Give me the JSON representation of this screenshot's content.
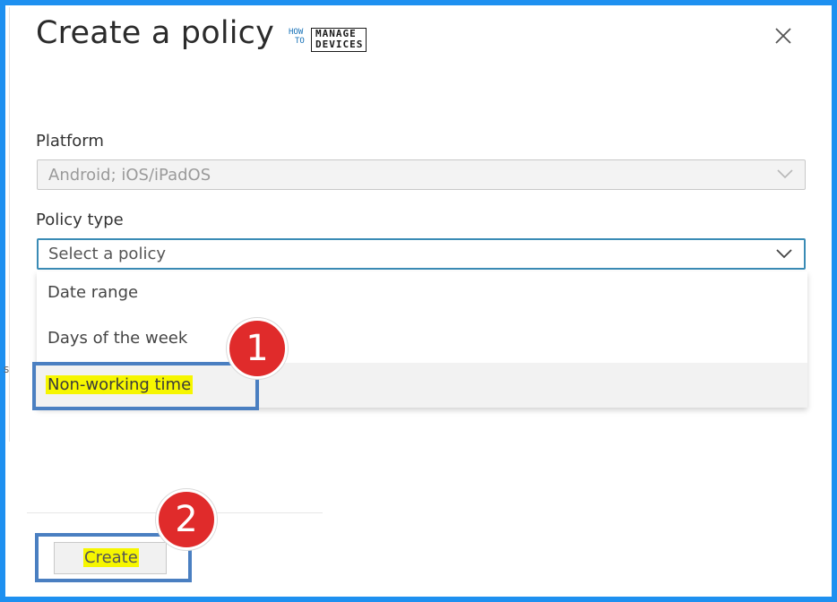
{
  "dialog": {
    "title": "Create a policy",
    "close_icon": "close-icon"
  },
  "logo": {
    "how": "HOW",
    "to": "TO",
    "manage": "MANAGE",
    "devices": "DEVICES"
  },
  "platform": {
    "label": "Platform",
    "value": "Android; iOS/iPadOS"
  },
  "policy_type": {
    "label": "Policy type",
    "placeholder": "Select a policy",
    "options": [
      "Date range",
      "Days of the week",
      "Non-working time"
    ]
  },
  "annotations": {
    "step1": "1",
    "step2": "2",
    "highlight_color": "#f6f600",
    "box_color": "#4a7fc1",
    "badge_color": "#e02b2b"
  },
  "footer": {
    "create_label": "Create"
  },
  "colors": {
    "frame_border": "#1e90f0",
    "focus_border": "#3a8bb5"
  }
}
